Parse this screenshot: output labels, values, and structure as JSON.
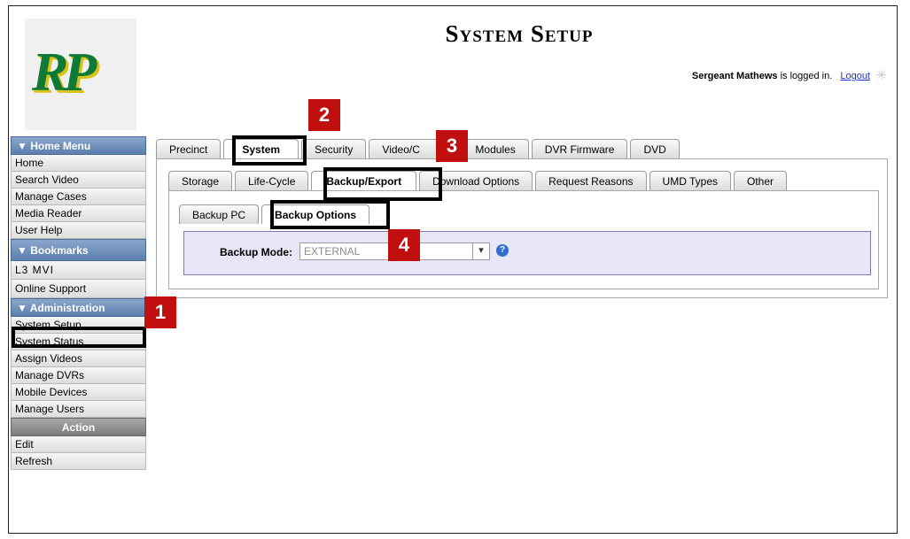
{
  "header": {
    "title": "System Setup",
    "logo_text": "RP",
    "user_name": "Sergeant Mathews",
    "logged_in_suffix": "is logged in.",
    "logout_label": "Logout"
  },
  "sidebar": {
    "home_menu": {
      "heading": "▼ Home Menu",
      "items": [
        "Home",
        "Search Video",
        "Manage Cases",
        "Media Reader",
        "User Help"
      ]
    },
    "bookmarks": {
      "heading": "▼  Bookmarks",
      "items": [
        "L3 MVI",
        "Online Support"
      ]
    },
    "administration": {
      "heading": "▼ Administration",
      "items": [
        "System Setup",
        "System Status",
        "Assign Videos",
        "Manage DVRs",
        "Mobile Devices",
        "Manage Users"
      ]
    },
    "action": {
      "heading": "Action",
      "items": [
        "Edit",
        "Refresh"
      ]
    }
  },
  "tabs_level1": [
    "Precinct",
    "System",
    "Security",
    "Video/C",
    "Modules",
    "DVR Firmware",
    "DVD"
  ],
  "tabs_level2": [
    "Storage",
    "Life-Cycle",
    "Backup/Export",
    "Download Options",
    "Request Reasons",
    "UMD Types",
    "Other"
  ],
  "tabs_level3": [
    "Backup PC",
    "Backup Options"
  ],
  "backup": {
    "label": "Backup Mode:",
    "value": "EXTERNAL",
    "help_icon": "question-circle-icon"
  },
  "callouts": [
    "1",
    "2",
    "3",
    "4"
  ],
  "colors": {
    "callout_red": "#c10f0f",
    "menu_blue": "#5c7fae",
    "logo_green": "#0f7a35"
  }
}
